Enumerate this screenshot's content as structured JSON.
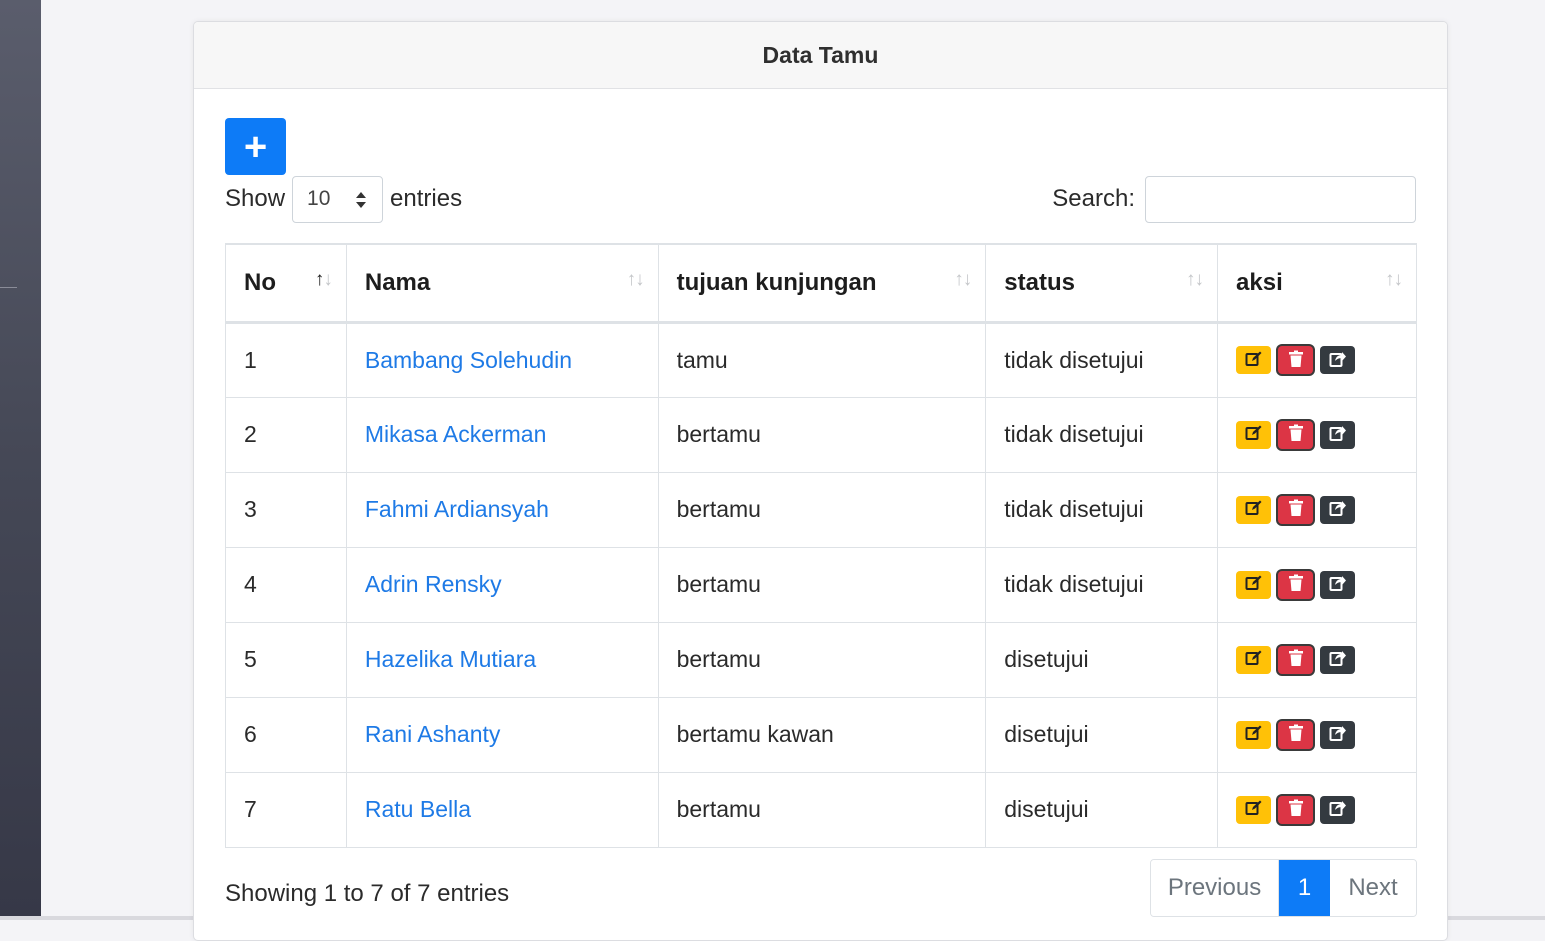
{
  "card": {
    "title": "Data Tamu"
  },
  "add_button": {
    "label": "+"
  },
  "length": {
    "show_label": "Show",
    "selected": "10",
    "entries_label": "entries"
  },
  "search": {
    "label": "Search:",
    "value": ""
  },
  "table": {
    "headers": [
      "No",
      "Nama",
      "tujuan kunjungan",
      "status",
      "aksi"
    ],
    "rows": [
      {
        "no": "1",
        "nama": "Bambang Solehudin",
        "tujuan": "tamu",
        "status": "tidak disetujui"
      },
      {
        "no": "2",
        "nama": "Mikasa Ackerman",
        "tujuan": "bertamu",
        "status": "tidak disetujui"
      },
      {
        "no": "3",
        "nama": "Fahmi Ardiansyah",
        "tujuan": "bertamu",
        "status": "tidak disetujui"
      },
      {
        "no": "4",
        "nama": "Adrin Rensky",
        "tujuan": "bertamu",
        "status": "tidak disetujui"
      },
      {
        "no": "5",
        "nama": "Hazelika Mutiara",
        "tujuan": "bertamu",
        "status": "disetujui"
      },
      {
        "no": "6",
        "nama": "Rani Ashanty",
        "tujuan": "bertamu kawan",
        "status": "disetujui"
      },
      {
        "no": "7",
        "nama": "Ratu Bella",
        "tujuan": "bertamu",
        "status": "disetujui"
      }
    ]
  },
  "info": "Showing 1 to 7 of 7 entries",
  "pagination": {
    "previous": "Previous",
    "current": "1",
    "next": "Next"
  },
  "icons": {
    "sort": "sort-arrows-icon",
    "edit": "edit-icon",
    "delete": "trash-icon",
    "share": "share-icon"
  },
  "colors": {
    "primary": "#0d7bf7",
    "warning": "#ffc107",
    "danger": "#dc3545",
    "dark": "#343a40",
    "link": "#1e7ae6"
  }
}
